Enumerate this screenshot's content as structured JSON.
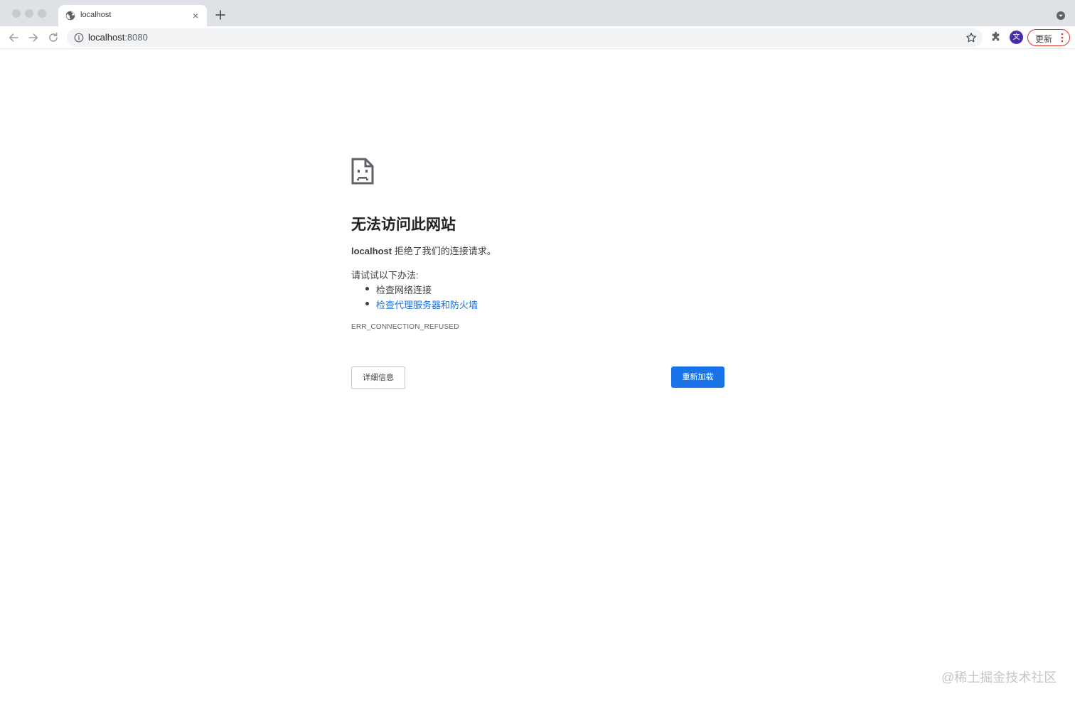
{
  "browser": {
    "tab": {
      "title": "localhost",
      "close_glyph": "×",
      "icon": "globe-icon"
    },
    "toolbar": {
      "url_host": "localhost",
      "url_port": ":8080",
      "profile_initial": "文",
      "update_label": "更新"
    }
  },
  "error_page": {
    "heading": "无法访问此网站",
    "summary_host": "localhost",
    "summary_text": " 拒绝了我们的连接请求。",
    "suggestions_title": "请试试以下办法:",
    "suggestions": [
      {
        "label": "检查网络连接",
        "is_link": false
      },
      {
        "label": "检查代理服务器和防火墙",
        "is_link": true
      }
    ],
    "error_code": "ERR_CONNECTION_REFUSED",
    "details_button": "详细信息",
    "reload_button": "重新加载"
  },
  "watermark": "@稀土掘金技术社区",
  "colors": {
    "accent": "#1a73e8",
    "update_border": "#d93025",
    "profile": "#4a2ea8"
  }
}
